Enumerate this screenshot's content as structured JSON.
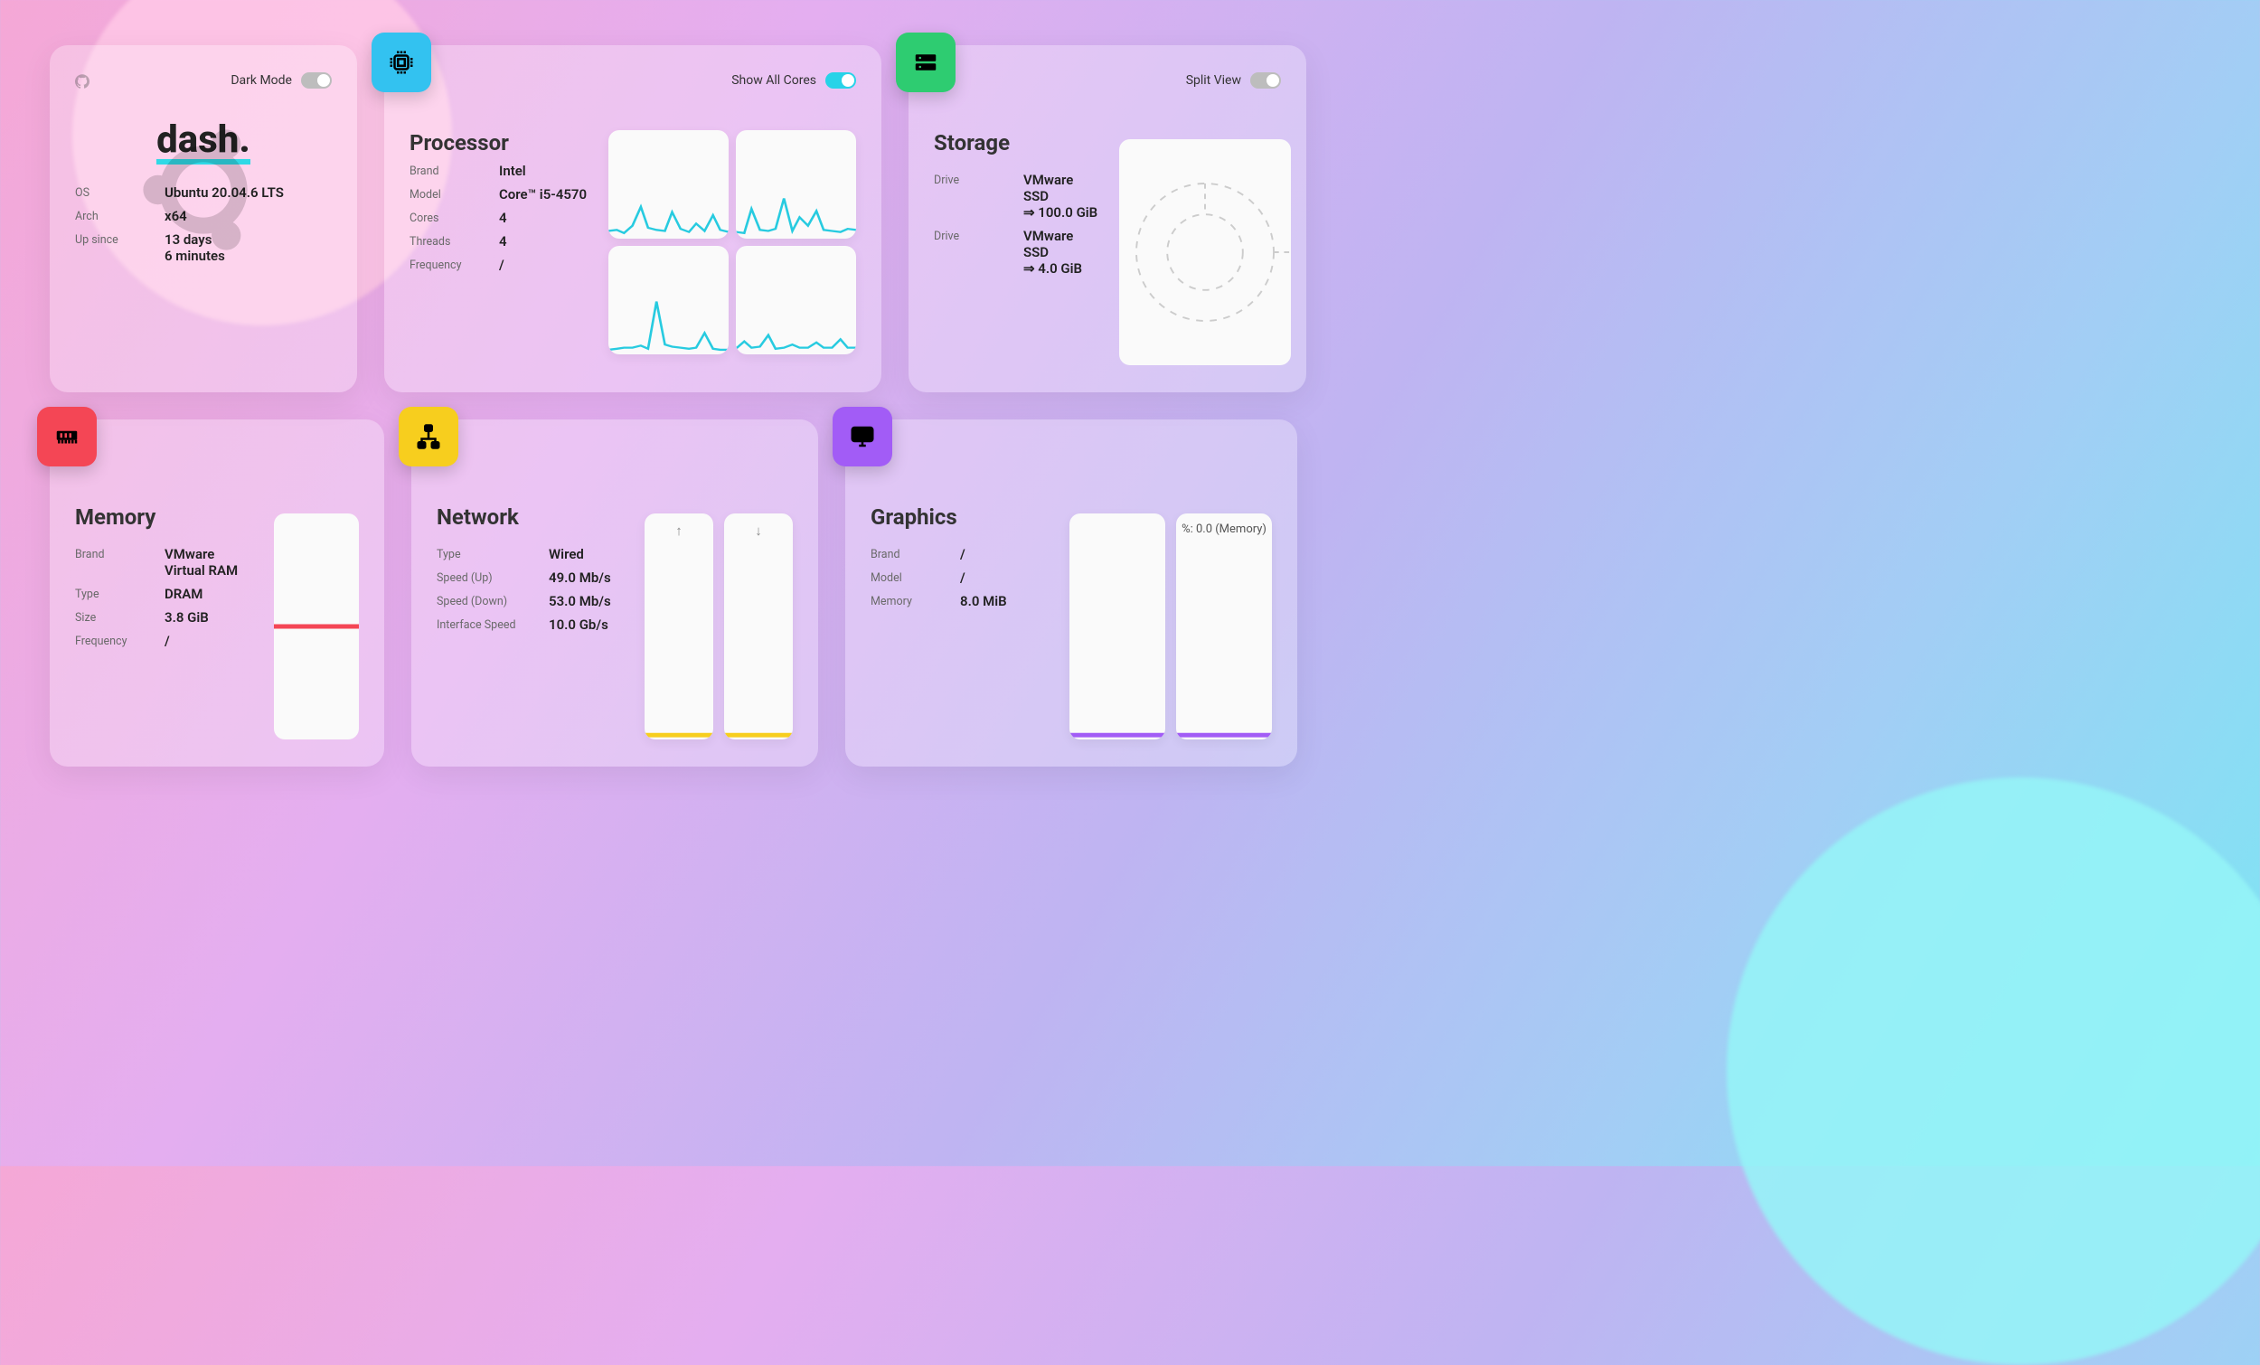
{
  "colors": {
    "cpu_badge": "#33c2f0",
    "storage_badge": "#2ecc71",
    "memory_badge": "#f44655",
    "network_badge": "#f7ce1e",
    "graphics_badge": "#a25cf6",
    "cpu_line": "#27cbe0",
    "memory_line": "#f44655",
    "network_line": "#f7ce1e",
    "graphics_line": "#a25cf6"
  },
  "info": {
    "logo": "dash.",
    "dark_mode_label": "Dark Mode",
    "os_label": "OS",
    "os_value": "Ubuntu 20.04.6 LTS",
    "arch_label": "Arch",
    "arch_value": "x64",
    "up_label": "Up since",
    "up_value_1": "13 days",
    "up_value_2": "6 minutes"
  },
  "cpu": {
    "title": "Processor",
    "toggle_label": "Show All Cores",
    "brand_label": "Brand",
    "brand": "Intel",
    "model_label": "Model",
    "model": "Core™ i5-4570",
    "cores_label": "Cores",
    "cores": "4",
    "threads_label": "Threads",
    "threads": "4",
    "freq_label": "Frequency",
    "freq": "/"
  },
  "storage": {
    "title": "Storage",
    "toggle_label": "Split View",
    "drive_label": "Drive",
    "d1_name": "VMware SSD",
    "d1_size": "⇒ 100.0 GiB",
    "d2_name": "VMware SSD",
    "d2_size": "⇒ 4.0 GiB"
  },
  "memory": {
    "title": "Memory",
    "brand_label": "Brand",
    "brand": "VMware Virtual RAM",
    "type_label": "Type",
    "type": "DRAM",
    "size_label": "Size",
    "size": "3.8 GiB",
    "freq_label": "Frequency",
    "freq": "/"
  },
  "network": {
    "title": "Network",
    "type_label": "Type",
    "type": "Wired",
    "up_label": "Speed (Up)",
    "up": "49.0 Mb/s",
    "down_label": "Speed (Down)",
    "down": "53.0 Mb/s",
    "iface_label": "Interface Speed",
    "iface": "10.0 Gb/s",
    "arrow_up": "↑",
    "arrow_down": "↓"
  },
  "graphics": {
    "title": "Graphics",
    "brand_label": "Brand",
    "brand": "/",
    "model_label": "Model",
    "model": "/",
    "mem_label": "Memory",
    "mem": "8.0 MiB",
    "overlay": "%: 0.0 (Memory)"
  },
  "chart_data": [
    {
      "type": "line",
      "title": "CPU core 0",
      "y_range": [
        0,
        100
      ],
      "values": [
        7,
        8,
        5,
        12,
        30,
        10,
        8,
        7,
        25,
        9,
        6,
        14,
        7,
        22,
        8
      ]
    },
    {
      "type": "line",
      "title": "CPU core 1",
      "y_range": [
        0,
        100
      ],
      "values": [
        6,
        5,
        28,
        8,
        7,
        9,
        38,
        7,
        20,
        12,
        26,
        8,
        7,
        6,
        9
      ]
    },
    {
      "type": "line",
      "title": "CPU core 2",
      "y_range": [
        0,
        100
      ],
      "values": [
        4,
        5,
        6,
        6,
        8,
        5,
        50,
        9,
        7,
        6,
        5,
        6,
        20,
        5,
        4
      ]
    },
    {
      "type": "line",
      "title": "CPU core 3",
      "y_range": [
        0,
        100
      ],
      "values": [
        5,
        12,
        6,
        7,
        18,
        5,
        6,
        9,
        6,
        6,
        11,
        6,
        6,
        14,
        6
      ]
    },
    {
      "type": "line",
      "title": "Memory usage %",
      "y_range": [
        0,
        100
      ],
      "values": [
        50,
        50,
        50,
        50,
        50,
        50,
        50,
        50,
        50,
        50,
        50,
        50
      ]
    },
    {
      "type": "line",
      "title": "Network Up",
      "y_range": [
        0,
        100
      ],
      "values": [
        2,
        2,
        2,
        2,
        2,
        2,
        2,
        2,
        2,
        2
      ]
    },
    {
      "type": "line",
      "title": "Network Down",
      "y_range": [
        0,
        100
      ],
      "values": [
        2,
        2,
        2,
        2,
        2,
        2,
        2,
        2,
        2,
        2
      ]
    },
    {
      "type": "line",
      "title": "GPU load",
      "y_range": [
        0,
        100
      ],
      "values": [
        2,
        2,
        2,
        2,
        2,
        2,
        2,
        2,
        2,
        2
      ]
    },
    {
      "type": "line",
      "title": "GPU memory",
      "y_range": [
        0,
        100
      ],
      "values": [
        2,
        2,
        2,
        2,
        2,
        2,
        2,
        2,
        2,
        2
      ]
    },
    {
      "type": "pie",
      "title": "Storage split",
      "series": [
        {
          "name": "VMware SSD 100 GiB",
          "value": 100
        },
        {
          "name": "VMware SSD 4 GiB",
          "value": 4
        }
      ],
      "note": "rendered placeholder / no fill visible"
    }
  ]
}
